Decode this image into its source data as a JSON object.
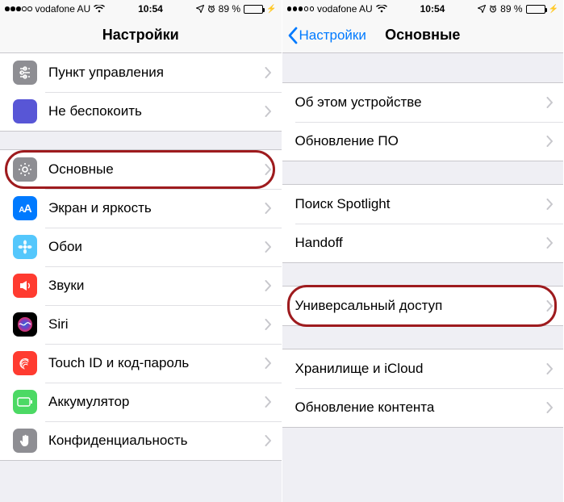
{
  "status": {
    "carrier": "vodafone AU",
    "time": "10:54",
    "battery_text": "89 %",
    "battery_fill_pct": 89
  },
  "left": {
    "title": "Настройки",
    "groups": [
      [
        {
          "key": "control-center",
          "label": "Пункт управления",
          "icon": "control-center",
          "color": "#8e8e93"
        },
        {
          "key": "dnd",
          "label": "Не беспокоить",
          "icon": "moon",
          "color": "#5856d6"
        }
      ],
      [
        {
          "key": "general",
          "label": "Основные",
          "icon": "gear",
          "color": "#8e8e93",
          "highlight": true
        },
        {
          "key": "display",
          "label": "Экран и яркость",
          "icon": "aa",
          "color": "#007aff"
        },
        {
          "key": "wallpaper",
          "label": "Обои",
          "icon": "flower",
          "color": "#54c7fc"
        },
        {
          "key": "sounds",
          "label": "Звуки",
          "icon": "speaker",
          "color": "#ff3b30"
        },
        {
          "key": "siri",
          "label": "Siri",
          "icon": "siri",
          "color": "#000000"
        },
        {
          "key": "touchid",
          "label": "Touch ID и код-пароль",
          "icon": "fingerprint",
          "color": "#ff3b30"
        },
        {
          "key": "battery",
          "label": "Аккумулятор",
          "icon": "battery",
          "color": "#4cd964"
        },
        {
          "key": "privacy",
          "label": "Конфиденциальность",
          "icon": "hand",
          "color": "#8e8e93"
        }
      ]
    ]
  },
  "right": {
    "back_label": "Настройки",
    "title": "Основные",
    "groups": [
      [
        {
          "key": "about",
          "label": "Об этом устройстве"
        },
        {
          "key": "software-update",
          "label": "Обновление ПО"
        }
      ],
      [
        {
          "key": "spotlight",
          "label": "Поиск Spotlight"
        },
        {
          "key": "handoff",
          "label": "Handoff"
        }
      ],
      [
        {
          "key": "accessibility",
          "label": "Универсальный доступ",
          "highlight": true
        }
      ],
      [
        {
          "key": "storage",
          "label": "Хранилище и iCloud"
        },
        {
          "key": "refresh",
          "label": "Обновление контента"
        }
      ]
    ]
  }
}
